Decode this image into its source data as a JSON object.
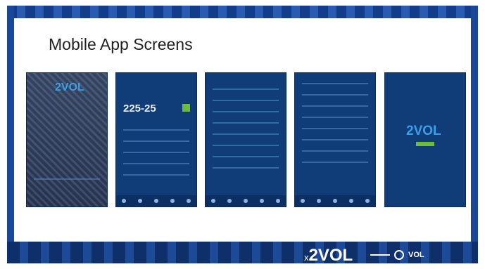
{
  "slide": {
    "title": "Mobile App Screens"
  },
  "screens": {
    "splash": {
      "logo": "2VOL"
    },
    "scoreboard": {
      "score": "225-25"
    },
    "final": {
      "logo": "2VOL"
    }
  },
  "footer": {
    "brand_prefix": "x",
    "brand": "2VOL",
    "partner": "VOL"
  },
  "colors": {
    "frame": "#1a4798",
    "phone_bg": "#103c78",
    "logo_blue": "#39a0e8",
    "accent_green": "#6ebd3a"
  }
}
